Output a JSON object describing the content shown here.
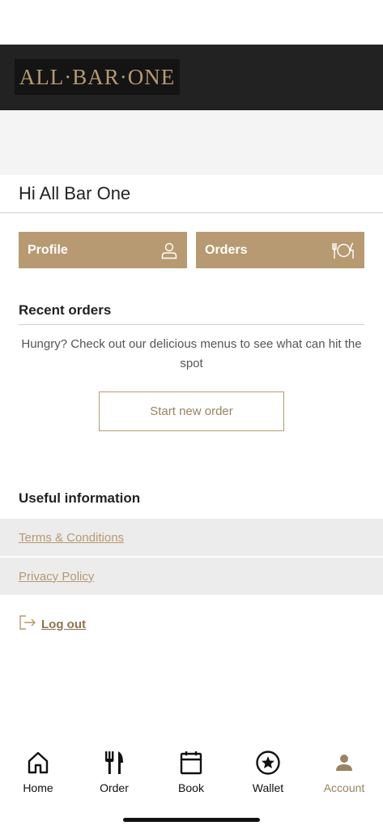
{
  "brand": {
    "logo_text": "ALL·BAR·ONE"
  },
  "greeting": "Hi All Bar One",
  "actions": {
    "profile_label": "Profile",
    "orders_label": "Orders"
  },
  "recent_orders": {
    "title": "Recent orders",
    "empty_message": "Hungry? Check out our delicious menus to see what can hit the spot",
    "start_button": "Start new order"
  },
  "useful_info": {
    "title": "Useful information",
    "links": [
      {
        "label": "Terms & Conditions"
      },
      {
        "label": "Privacy Policy"
      }
    ]
  },
  "logout_label": "Log out",
  "tabs": [
    {
      "label": "Home",
      "icon": "home-icon"
    },
    {
      "label": "Order",
      "icon": "cutlery-icon"
    },
    {
      "label": "Book",
      "icon": "calendar-icon"
    },
    {
      "label": "Wallet",
      "icon": "star-circle-icon"
    },
    {
      "label": "Account",
      "icon": "person-icon",
      "active": true
    }
  ],
  "colors": {
    "accent": "#b79a71",
    "header_bg": "#222222",
    "link_row_bg": "#ececec"
  }
}
